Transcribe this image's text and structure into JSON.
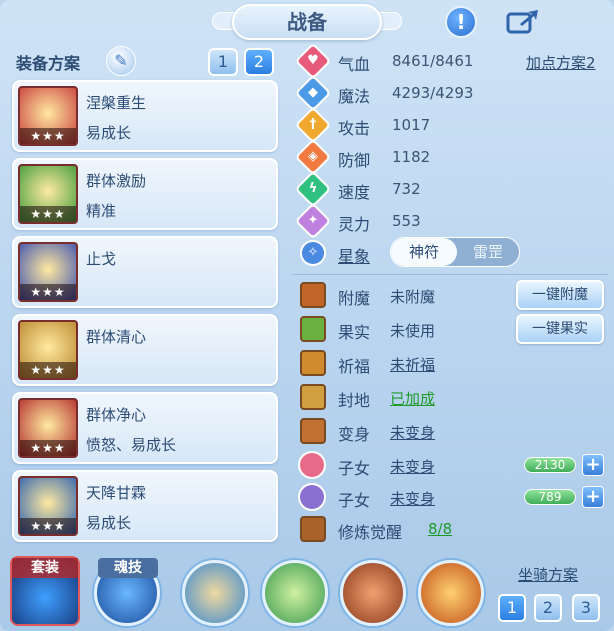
{
  "header": {
    "title": "战备",
    "help_icon": "!"
  },
  "equip": {
    "scheme_label": "装备方案",
    "tabs": [
      "1",
      "2"
    ],
    "active_tab": 1,
    "items": [
      {
        "name": "涅槃重生",
        "sub": "易成长",
        "stars": "★★★",
        "color": "#c73b3b"
      },
      {
        "name": "群体激励",
        "sub": "精准",
        "stars": "★★★",
        "color": "#3a9a3a"
      },
      {
        "name": "止戈",
        "sub": "",
        "stars": "★★★",
        "color": "#3a4fb0"
      },
      {
        "name": "群体清心",
        "sub": "",
        "stars": "★★★",
        "color": "#b8862a"
      },
      {
        "name": "群体净心",
        "sub": "愤怒、易成长",
        "stars": "★★★",
        "color": "#b02a2a"
      },
      {
        "name": "天降甘霖",
        "sub": "易成长",
        "stars": "★★★",
        "color": "#2a5fb0"
      }
    ]
  },
  "stats": {
    "addpoint_label": "加点方案2",
    "rows": [
      {
        "label": "气血",
        "value": "8461/8461",
        "icon": "heart-icon",
        "color": "#e85a7a",
        "glyph": "♥"
      },
      {
        "label": "魔法",
        "value": "4293/4293",
        "icon": "mana-icon",
        "color": "#4a9ae8",
        "glyph": "◆"
      },
      {
        "label": "攻击",
        "value": "1017",
        "icon": "sword-icon",
        "color": "#f0a830",
        "glyph": "†"
      },
      {
        "label": "防御",
        "value": "1182",
        "icon": "shield-icon",
        "color": "#f07a40",
        "glyph": "◈"
      },
      {
        "label": "速度",
        "value": "732",
        "icon": "lightning-icon",
        "color": "#30c080",
        "glyph": "ϟ"
      },
      {
        "label": "灵力",
        "value": "553",
        "icon": "spirit-icon",
        "color": "#c080e0",
        "glyph": "✦"
      }
    ],
    "astro": {
      "label": "星象",
      "options": [
        "神符",
        "雷罡"
      ],
      "active": 0
    }
  },
  "misc": {
    "rows": [
      {
        "label": "附魔",
        "value": "未附魔",
        "underline": false,
        "green": false,
        "icon": "enchant-icon"
      },
      {
        "label": "果实",
        "value": "未使用",
        "underline": false,
        "green": false,
        "icon": "fruit-icon"
      },
      {
        "label": "祈福",
        "value": "未祈福",
        "underline": true,
        "green": false,
        "icon": "bless-icon"
      },
      {
        "label": "封地",
        "value": "已加成",
        "underline": true,
        "green": true,
        "icon": "fief-icon"
      },
      {
        "label": "变身",
        "value": "未变身",
        "underline": true,
        "green": false,
        "icon": "transform-icon"
      }
    ],
    "buttons": [
      "一键附魔",
      "一键果实"
    ],
    "children": [
      {
        "label": "子女",
        "value": "未变身",
        "exp": "2130",
        "icon": "child1-icon"
      },
      {
        "label": "子女",
        "value": "未变身",
        "exp": "789",
        "icon": "child2-icon"
      }
    ],
    "cultivation": {
      "label": "修炼觉醒",
      "value": "8/8"
    }
  },
  "bottom": {
    "suit_label": "套装",
    "soul_label": "魂技",
    "mount_label": "坐骑方案",
    "mount_tabs": [
      "1",
      "2",
      "3"
    ],
    "mount_active": 0
  }
}
